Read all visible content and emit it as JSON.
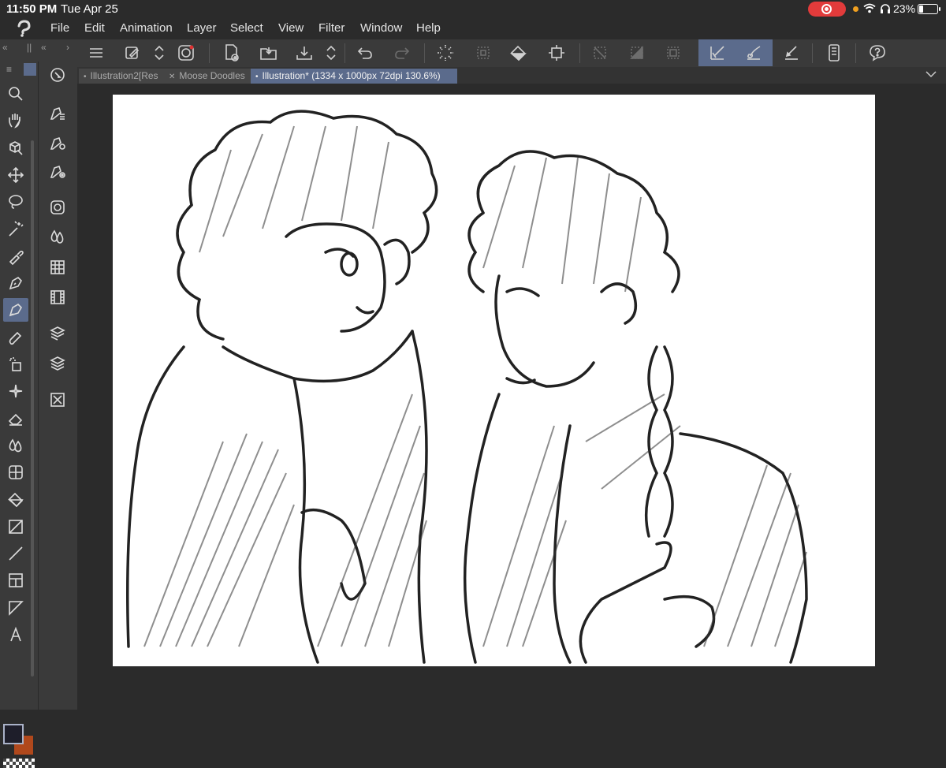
{
  "status": {
    "time": "11:50 PM",
    "date": "Tue Apr 25",
    "battery": "23%",
    "battery_level": 0.23
  },
  "menu": [
    "File",
    "Edit",
    "Animation",
    "Layer",
    "Select",
    "View",
    "Filter",
    "Window",
    "Help"
  ],
  "tabs": [
    {
      "label": "Illustration2[Res",
      "mark": "•"
    },
    {
      "label": "Moose Doodles",
      "mark": "✕"
    },
    {
      "label": "Illustration* (1334 x 1000px 72dpi 130.6%)",
      "mark": "•"
    }
  ],
  "colors": {
    "accent": "#5b6b8c",
    "main_color": "#1e1e2a",
    "sub_color": "#b0481c",
    "record": "#e23b3b"
  },
  "tools": [
    "zoom-icon",
    "hand-icon",
    "3d-object-icon",
    "move-icon",
    "lasso-icon",
    "magic-wand-icon",
    "eyedropper-icon",
    "pen-icon",
    "pencil-icon",
    "brush-icon",
    "airbrush-icon",
    "decoration-icon",
    "eraser-icon",
    "blend-icon",
    "figure-icon",
    "fill-icon",
    "gradient-icon",
    "line-icon",
    "frame-icon",
    "balloon-icon",
    "text-icon"
  ]
}
